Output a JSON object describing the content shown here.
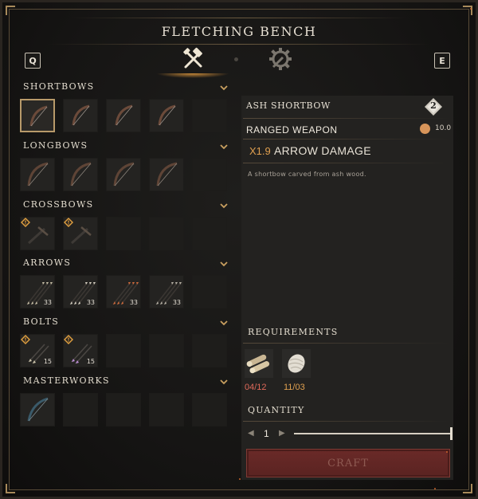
{
  "window": {
    "title": "FLETCHING BENCH"
  },
  "tabs": {
    "prev_key": "Q",
    "next_key": "E",
    "items": [
      {
        "icon": "crafting-hammer-icon",
        "active": true
      },
      {
        "icon": "gear-wrench-icon",
        "active": false
      }
    ]
  },
  "categories": [
    {
      "label": "SHORTBOWS",
      "items": [
        {
          "icon": "shortbow-icon",
          "selected": true
        },
        {
          "icon": "shortbow-icon"
        },
        {
          "icon": "shortbow-icon"
        },
        {
          "icon": "shortbow-icon"
        },
        {
          "icon": "empty"
        }
      ]
    },
    {
      "label": "LONGBOWS",
      "items": [
        {
          "icon": "longbow-icon"
        },
        {
          "icon": "longbow-icon"
        },
        {
          "icon": "longbow-icon"
        },
        {
          "icon": "longbow-icon"
        },
        {
          "icon": "empty"
        }
      ]
    },
    {
      "label": "CROSSBOWS",
      "items": [
        {
          "icon": "crossbow-icon",
          "warning": true
        },
        {
          "icon": "crossbow-icon",
          "warning": true
        },
        {
          "icon": "empty"
        },
        {
          "icon": "empty"
        },
        {
          "icon": "empty"
        }
      ]
    },
    {
      "label": "ARROWS",
      "items": [
        {
          "icon": "arrows-icon",
          "count": "33",
          "tint": "#c9c1a8"
        },
        {
          "icon": "arrows-icon",
          "count": "33",
          "tint": "#d8d2c4"
        },
        {
          "icon": "arrows-icon",
          "count": "33",
          "tint": "#d06a3a"
        },
        {
          "icon": "arrows-icon",
          "count": "33",
          "tint": "#b8b2a6"
        },
        {
          "icon": "empty"
        }
      ]
    },
    {
      "label": "BOLTS",
      "items": [
        {
          "icon": "bolts-icon",
          "count": "15",
          "warning": true,
          "tint": "#c9c1a8"
        },
        {
          "icon": "bolts-icon",
          "count": "15",
          "warning": true,
          "tint": "#b88ad0"
        },
        {
          "icon": "empty"
        },
        {
          "icon": "empty"
        },
        {
          "icon": "empty"
        }
      ]
    },
    {
      "label": "MASTERWORKS",
      "items": [
        {
          "icon": "masterwork-bow-icon"
        },
        {
          "icon": "empty"
        },
        {
          "icon": "empty"
        },
        {
          "icon": "empty"
        },
        {
          "icon": "empty"
        }
      ]
    }
  ],
  "detail": {
    "name": "ASH SHORTBOW",
    "tier": "2",
    "type": "RANGED WEAPON",
    "weight": "10.0",
    "stat_multiplier": "X1.9",
    "stat_name": "ARROW DAMAGE",
    "description": "A shortbow carved from ash wood.",
    "requirements_title": "REQUIREMENTS",
    "requirements": [
      {
        "icon": "wood-logs-icon",
        "count": "04/12",
        "color": "#e06a5a"
      },
      {
        "icon": "wool-bundle-icon",
        "count": "11/03",
        "color": "#e0a050"
      }
    ],
    "quantity_title": "QUANTITY",
    "quantity": "1",
    "quantity_fraction": 1.0,
    "craft_label": "CRAFT"
  },
  "colors": {
    "accent": "#e0a050",
    "selection_border": "#b89a6a",
    "craft_button": "#5a2321"
  }
}
